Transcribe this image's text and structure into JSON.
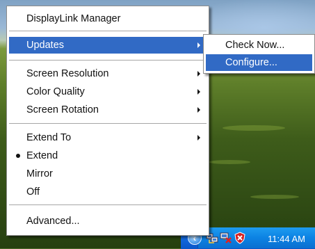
{
  "menu": {
    "items": [
      {
        "label": "DisplayLink Manager"
      },
      {
        "label": "Updates"
      },
      {
        "label": "Screen Resolution"
      },
      {
        "label": "Color Quality"
      },
      {
        "label": "Screen Rotation"
      },
      {
        "label": "Extend To"
      },
      {
        "label": "Extend"
      },
      {
        "label": "Mirror"
      },
      {
        "label": "Off"
      },
      {
        "label": "Advanced..."
      }
    ]
  },
  "submenu": {
    "items": [
      {
        "label": "Check Now..."
      },
      {
        "label": "Configure..."
      }
    ]
  },
  "taskbar": {
    "clock": "11:44 AM",
    "icons": [
      "show-hidden-icons-chevron",
      "network-icon",
      "network-disconnected-icon",
      "security-alert-icon"
    ]
  },
  "colors": {
    "selection": "#316ac5",
    "menu_background": "#ffffff",
    "taskbar": "#0c82e3"
  }
}
